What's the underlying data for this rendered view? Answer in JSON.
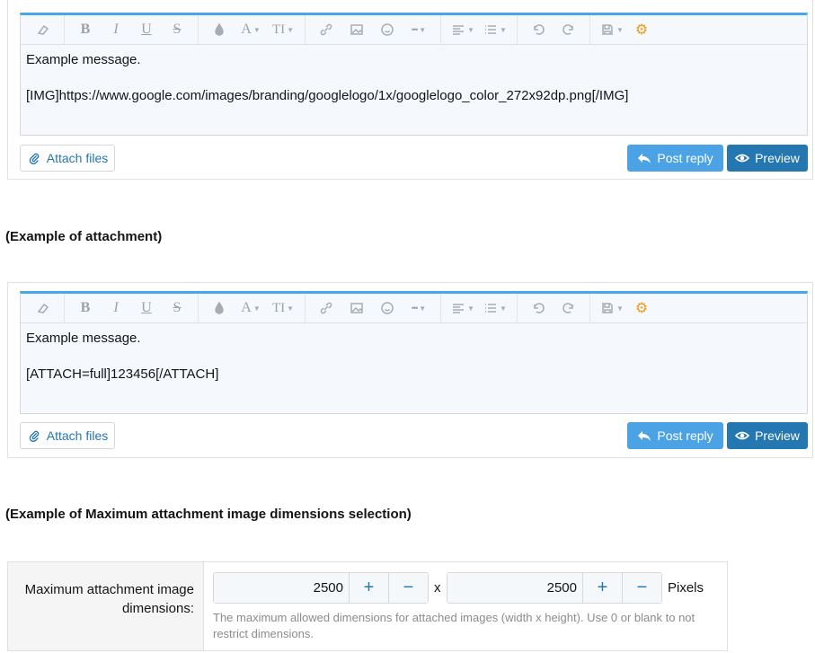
{
  "editors": [
    {
      "lines": [
        "Example message.",
        "[IMG]https://www.google.com/images/branding/googlelogo/1x/googlelogo_color_272x92dp.png[/IMG]"
      ],
      "attach_label": "Attach files",
      "post_label": "Post reply",
      "preview_label": "Preview"
    },
    {
      "lines": [
        "Example message.",
        "[ATTACH=full]123456[/ATTACH]"
      ],
      "attach_label": "Attach files",
      "post_label": "Post reply",
      "preview_label": "Preview"
    }
  ],
  "toolbar": {
    "bold": "B",
    "italic": "I",
    "underline": "U",
    "strike": "S",
    "font": "A",
    "size": "TI",
    "more": "•••"
  },
  "headings": {
    "attachment": "(Example of attachment)",
    "dimensions": "(Example of Maximum attachment image dimensions selection)"
  },
  "option": {
    "label": "Maximum attachment image dimensions:",
    "width_value": "2500",
    "height_value": "2500",
    "plus": "+",
    "minus": "−",
    "separator": "x",
    "unit": "Pixels",
    "hint": "The maximum allowed dimensions for attached images (width x height). Use 0 or blank to not restrict dimensions."
  },
  "colors": {
    "accent": "#47a7eb",
    "post_button": "#4ba3e6",
    "preview_button": "#2577b1",
    "gear": "#f19a1a"
  }
}
